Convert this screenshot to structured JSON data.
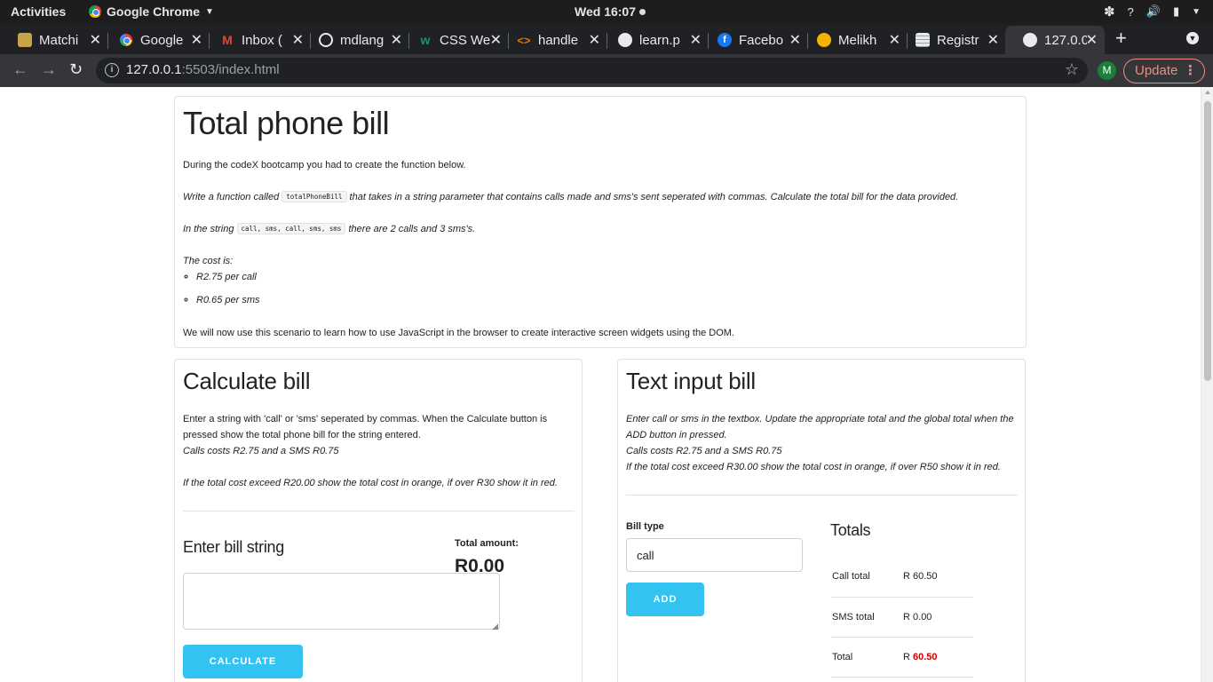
{
  "os_bar": {
    "activities": "Activities",
    "app_name": "Google Chrome",
    "clock": "Wed 16:07"
  },
  "tabs": [
    {
      "title": "Matchi",
      "favicon": "folder-icon",
      "color": "#c9a34a"
    },
    {
      "title": "Google",
      "favicon": "google-icon",
      "color": "#4285f4"
    },
    {
      "title": "Inbox (",
      "favicon": "gmail-icon",
      "color": "#ea4335"
    },
    {
      "title": "mdlang",
      "favicon": "github-icon",
      "color": "#e8eaed"
    },
    {
      "title": "CSS We",
      "favicon": "w3-icon",
      "color": "#0f9d58"
    },
    {
      "title": "handle",
      "favicon": "code-icon",
      "color": "#e37400"
    },
    {
      "title": "learn.p",
      "favicon": "globe-icon",
      "color": "#e8eaed"
    },
    {
      "title": "Facebo",
      "favicon": "facebook-icon",
      "color": "#1877f2"
    },
    {
      "title": "Melikh",
      "favicon": "melikh-icon",
      "color": "#f4b400"
    },
    {
      "title": "Registr",
      "favicon": "sheet-icon",
      "color": "#e8eaed"
    },
    {
      "title": "127.0.0",
      "favicon": "globe-icon",
      "color": "#e8eaed"
    }
  ],
  "address_bar": {
    "host": "127.0.0.1",
    "rest": ":5503/index.html"
  },
  "profile_initial": "M",
  "update_label": "Update",
  "intro": {
    "title": "Total phone bill",
    "p1": "During the codeX bootcamp you had to create the function below.",
    "p2_before": "Write a function called ",
    "p2_code": "totalPhoneBill",
    "p2_after": " that takes in a string parameter that contains calls made and sms's sent seperated with commas. Calculate the total bill for the data provided.",
    "p3_before": "In the string ",
    "p3_code": "call, sms, call, sms, sms",
    "p3_after": " there are 2 calls and 3 sms's.",
    "cost_heading": "The cost is:",
    "costs": [
      "R2.75 per call",
      "R0.65 per sms"
    ],
    "p4": "We will now use this scenario to learn how to use JavaScript in the browser to create interactive screen widgets using the DOM."
  },
  "calculate": {
    "title": "Calculate bill",
    "desc1": "Enter a string with 'call' or 'sms' seperated by commas. When the Calculate button is pressed show the total phone bill for the string entered.",
    "desc2": "Calls costs R2.75 and a SMS R0.75",
    "desc3": "If the total cost exceed R20.00 show the total cost in orange, if over R30 show it in red.",
    "input_label": "Enter bill string",
    "total_label": "Total amount:",
    "total_value": "R0.00",
    "button": "CALCULATE"
  },
  "text_input": {
    "title": "Text input bill",
    "desc1": "Enter call or sms in the textbox. Update the appropriate total and the global total when the ADD button in pressed.",
    "desc2": "Calls costs R2.75 and a SMS R0.75",
    "desc3": "If the total cost exceed R30.00 show the total cost in orange, if over R50 show it in red.",
    "bill_type_label": "Bill type",
    "bill_type_value": "call",
    "button": "ADD",
    "totals_title": "Totals",
    "rows": [
      {
        "label": "Call total",
        "currency": "R",
        "value": "60.50"
      },
      {
        "label": "SMS total",
        "currency": "R",
        "value": "0.00"
      },
      {
        "label": "Total",
        "currency": "R",
        "value": "60.50"
      }
    ],
    "warning_color": "#d50000"
  }
}
